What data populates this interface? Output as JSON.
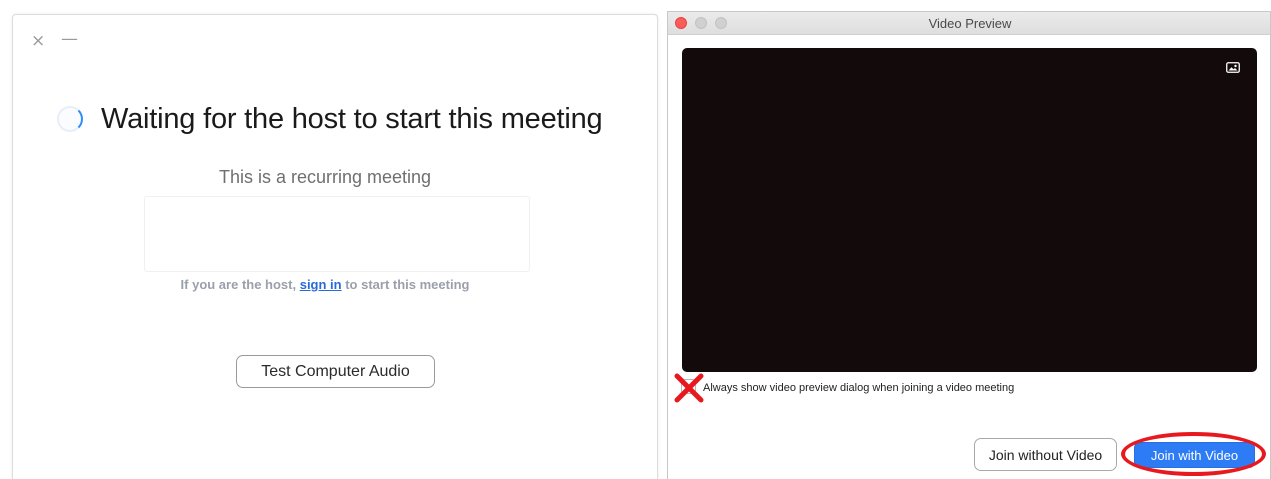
{
  "waiting_window": {
    "close_glyph": "×",
    "minimize_glyph": "—",
    "title": "Waiting for the host to start this meeting",
    "recurring_text": "This is a recurring meeting",
    "host_prefix": "If you are the host, ",
    "host_link": "sign in",
    "host_suffix": " to start this meeting",
    "test_audio_label": "Test Computer Audio"
  },
  "preview_window": {
    "title": "Video Preview",
    "always_show_label": "Always show video preview dialog when joining a video meeting",
    "always_show_checked": false,
    "join_without_video_label": "Join without Video",
    "join_with_video_label": "Join with Video"
  },
  "colors": {
    "accent_blue": "#2d7cf6",
    "link_blue": "#2a6ad8",
    "annotation_red": "#e8191e",
    "video_background": "#130b0b"
  },
  "annotations": {
    "checkbox_mark": "red-cross",
    "join_with_video_highlight": "red-ellipse"
  }
}
